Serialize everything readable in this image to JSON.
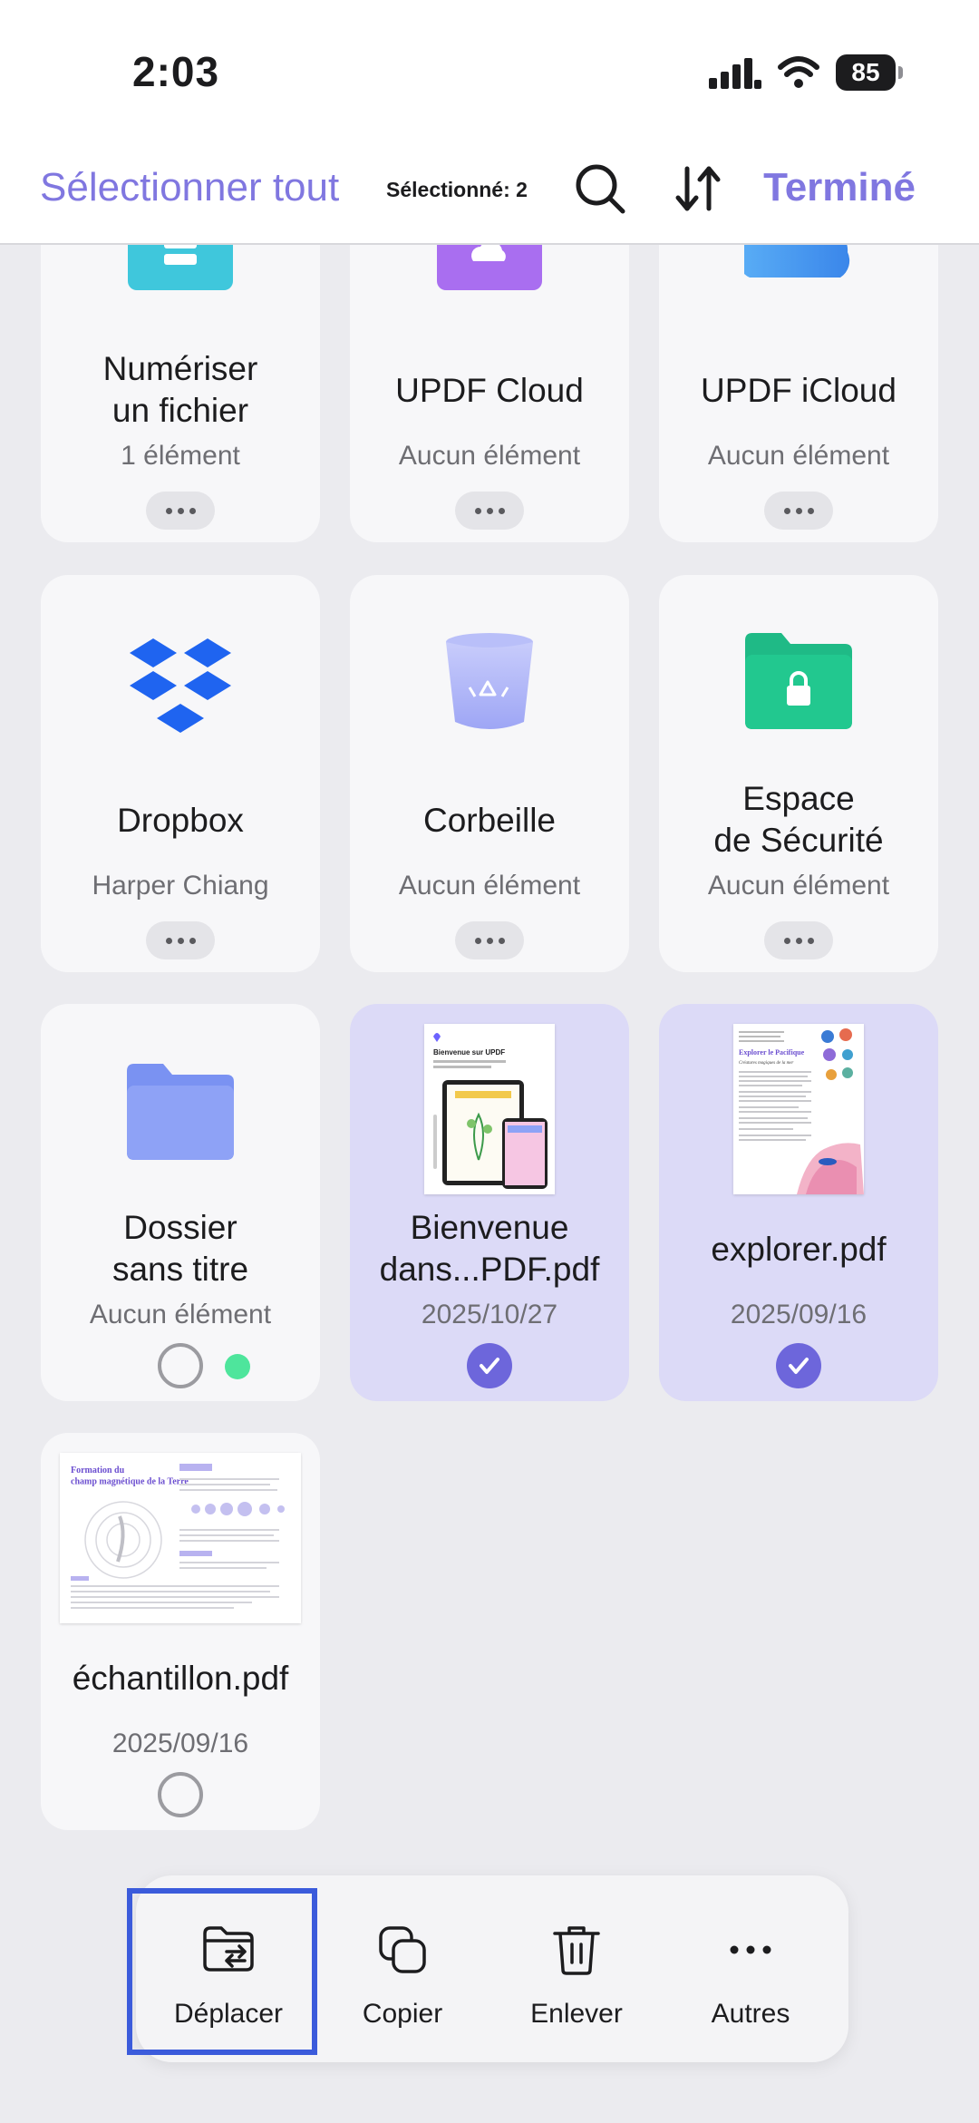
{
  "status_bar": {
    "time": "2:03",
    "battery": "85"
  },
  "header": {
    "select_all": "Sélectionner tout",
    "selected_count": "Sélectionné: 2",
    "done": "Terminé"
  },
  "cards": [
    {
      "title": "Numériser\nun fichier",
      "subtitle": "1 élément",
      "icon": "scan-folder-icon"
    },
    {
      "title": "UPDF Cloud",
      "subtitle": "Aucun élément",
      "icon": "updf-cloud-icon"
    },
    {
      "title": "UPDF iCloud",
      "subtitle": "Aucun élément",
      "icon": "icloud-icon"
    },
    {
      "title": "Dropbox",
      "subtitle": "Harper Chiang",
      "icon": "dropbox-icon"
    },
    {
      "title": "Corbeille",
      "subtitle": "Aucun élément",
      "icon": "trash-bin-icon"
    },
    {
      "title": "Espace\nde Sécurité",
      "subtitle": "Aucun élément",
      "icon": "secure-folder-icon"
    },
    {
      "title": "Dossier\nsans titre",
      "subtitle": "Aucun élément",
      "icon": "folder-icon",
      "selected": false
    },
    {
      "title": "Bienvenue\ndans...PDF.pdf",
      "subtitle": "2025/10/27",
      "icon": "pdf-thumbnail",
      "selected": true
    },
    {
      "title": "explorer.pdf",
      "subtitle": "2025/09/16",
      "icon": "pdf-thumbnail",
      "selected": true
    },
    {
      "title": "échantillon.pdf",
      "subtitle": "2025/09/16",
      "icon": "pdf-thumbnail",
      "selected": false
    }
  ],
  "thumbnails": {
    "welcome": {
      "heading": "Bienvenue sur UPDF"
    },
    "explorer": {
      "heading": "Explorer le Pacifique",
      "subheading": "Créatures magiques de la mer"
    },
    "sample": {
      "heading": "Formation du\nchamp magnétique de la Terre"
    }
  },
  "actions": [
    {
      "label": "Déplacer",
      "icon": "move-folder-icon"
    },
    {
      "label": "Copier",
      "icon": "copy-icon"
    },
    {
      "label": "Enlever",
      "icon": "trash-icon"
    },
    {
      "label": "Autres",
      "icon": "more-icon"
    }
  ],
  "colors": {
    "accent": "#8077e0",
    "selected_card": "#dcdaf7",
    "highlight": "#3b5bdb"
  }
}
